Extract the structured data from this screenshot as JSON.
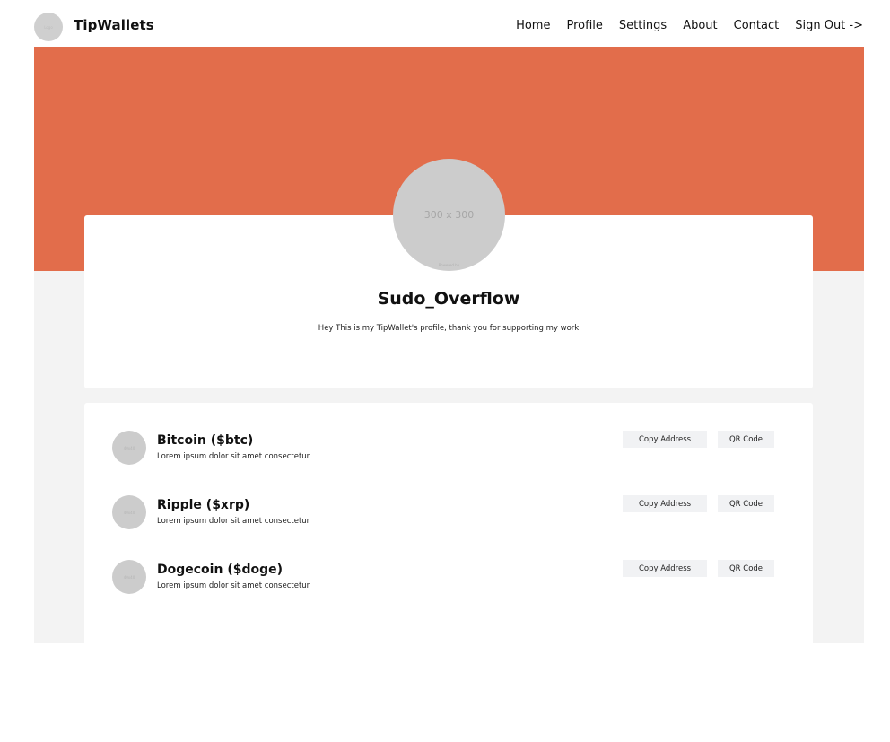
{
  "nav": {
    "logo_text": "Logo",
    "brand": "TipWallets",
    "items": [
      "Home",
      "Profile",
      "Settings",
      "About",
      "Contact",
      "Sign Out ->"
    ]
  },
  "profile": {
    "avatar_text": "300 x 300",
    "avatar_watermark": "Powered by",
    "username": "Sudo_Overflow",
    "bio": "Hey This is my TipWallet's profile, thank you for supporting my work"
  },
  "wallets": [
    {
      "icon_text": "40x40",
      "name": "Bitcoin ($btc)",
      "description": "Lorem ipsum dolor sit amet consectetur",
      "copy_label": "Copy Address",
      "qr_label": "QR Code"
    },
    {
      "icon_text": "40x40",
      "name": "Ripple ($xrp)",
      "description": "Lorem ipsum dolor sit amet consectetur",
      "copy_label": "Copy Address",
      "qr_label": "QR Code"
    },
    {
      "icon_text": "40x40",
      "name": "Dogecoin ($doge)",
      "description": "Lorem ipsum dolor sit amet consectetur",
      "copy_label": "Copy Address",
      "qr_label": "QR Code"
    }
  ],
  "colors": {
    "banner": "#e26d4b",
    "background": "#f3f3f3",
    "card": "#ffffff",
    "button": "#f1f2f4"
  }
}
